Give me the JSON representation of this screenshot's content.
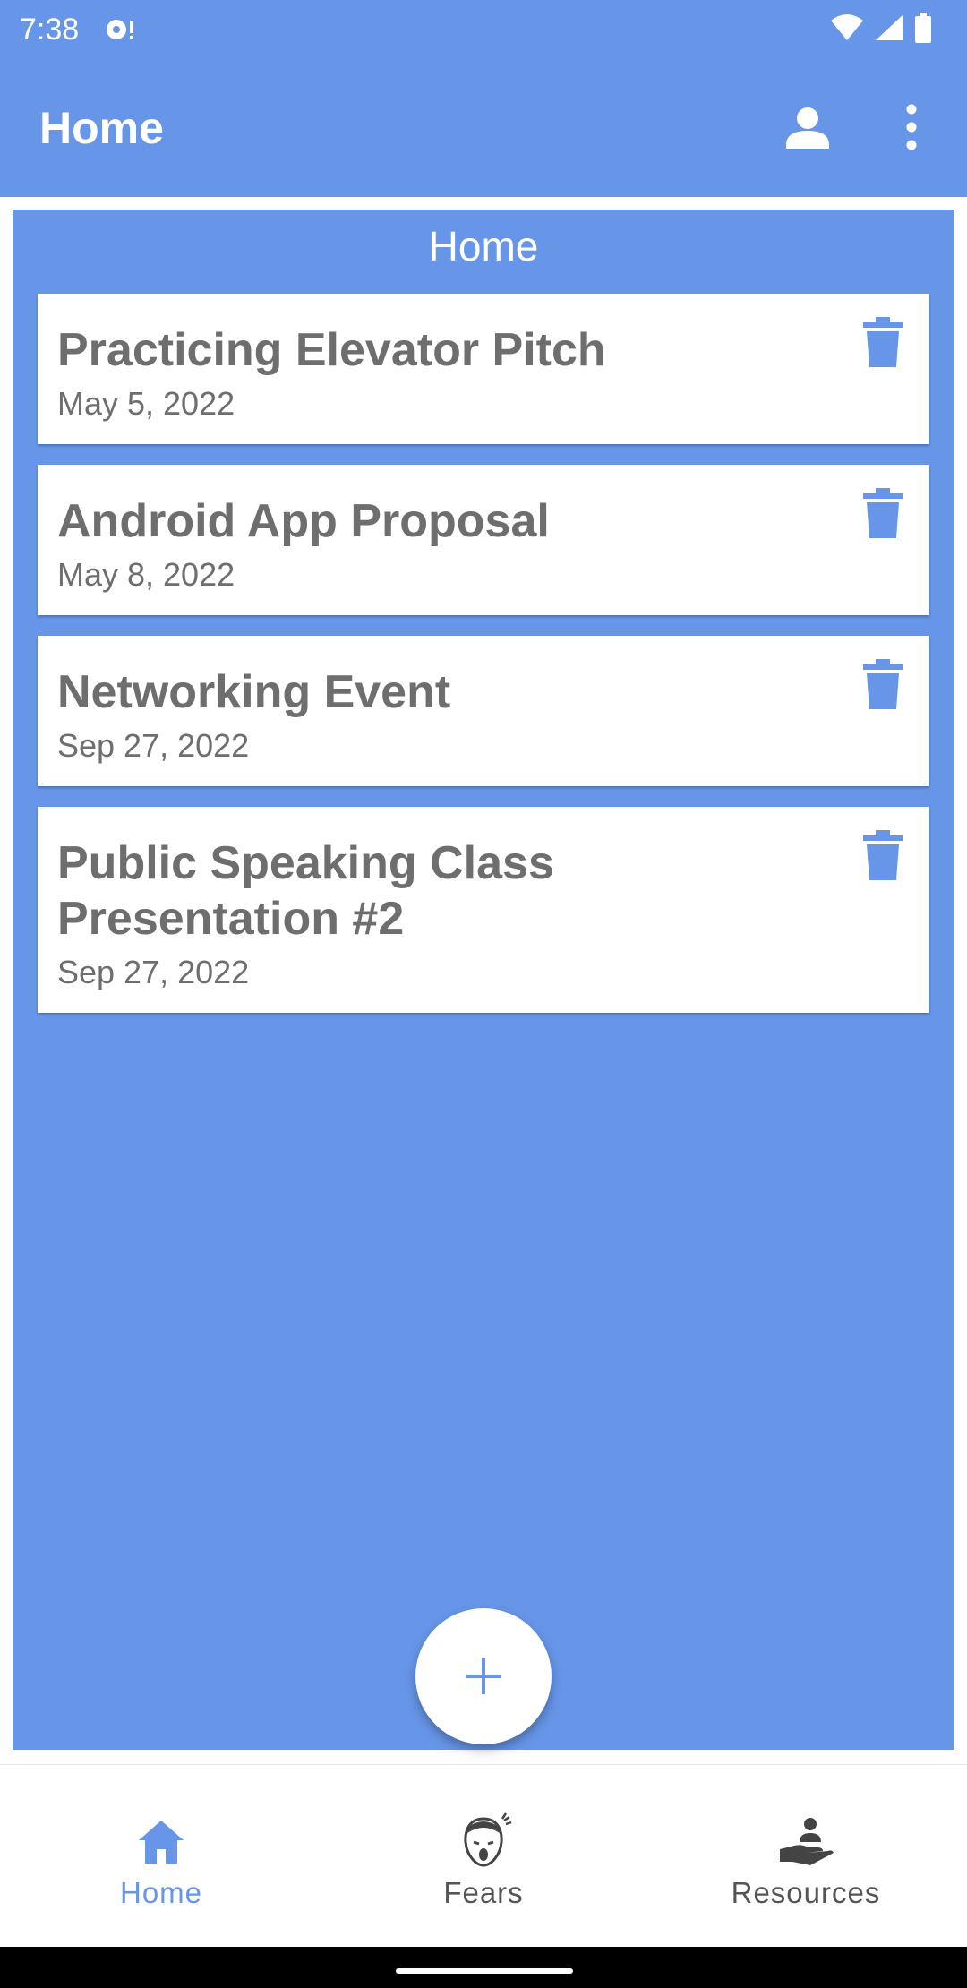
{
  "status_bar": {
    "time": "7:38"
  },
  "app_bar": {
    "title": "Home"
  },
  "content": {
    "heading": "Home"
  },
  "cards": [
    {
      "title": "Practicing Elevator Pitch",
      "date": "May 5, 2022"
    },
    {
      "title": "Android App Proposal",
      "date": "May 8, 2022"
    },
    {
      "title": "Networking Event",
      "date": "Sep 27, 2022"
    },
    {
      "title": "Public Speaking Class Presentation #2",
      "date": "Sep 27, 2022"
    }
  ],
  "bottom_nav": [
    {
      "label": "Home",
      "icon": "home-icon",
      "active": true
    },
    {
      "label": "Fears",
      "icon": "fears-face-icon",
      "active": false
    },
    {
      "label": "Resources",
      "icon": "hand-person-icon",
      "active": false
    }
  ],
  "colors": {
    "primary": "#6796e9",
    "card_text": "#6e6e6e",
    "inactive_nav": "#555555"
  }
}
